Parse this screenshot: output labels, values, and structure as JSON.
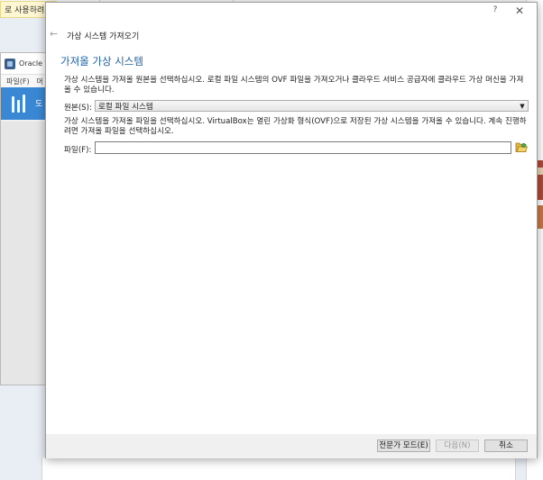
{
  "background": {
    "notice_text": "로 사용하려면",
    "app_window": {
      "title": "Oracle V",
      "menu_item": "파일(F)",
      "menu_item_2": "머",
      "tool_label": "도"
    }
  },
  "dialog": {
    "titlebar": {
      "help_label": "?",
      "close_label": "✕"
    },
    "header": {
      "back_icon": "←",
      "wizard_name": "가상 시스템 가져오기"
    },
    "page_title": "가져올 가상 시스템",
    "intro_text": "가상 시스템을 가져올 원본을 선택하십시오. 로컬 파일 시스템의 OVF 파일을 가져오거나 클라우드 서비스 공급자에 클라우드 가상 머신을 가져올 수 있습니다.",
    "source": {
      "label": "원본(S):",
      "selected": "로컬 파일 시스템"
    },
    "description": "가상 시스템을 가져올 파일을 선택하십시오. VirtualBox는 열린 가상화 형식(OVF)으로 저장된 가상 시스템을 가져올 수 있습니다. 계속 진행하려면 가져올 파일을 선택하십시오.",
    "file": {
      "label": "파일(F):",
      "value": "",
      "browse_icon": "folder-open-icon"
    },
    "buttons": {
      "expert": "전문가 모드(E)",
      "next": "다음(N)",
      "cancel": "취소"
    }
  },
  "colors": {
    "title_blue": "#1e62a8",
    "toolbar_blue": "#3a88d4"
  }
}
